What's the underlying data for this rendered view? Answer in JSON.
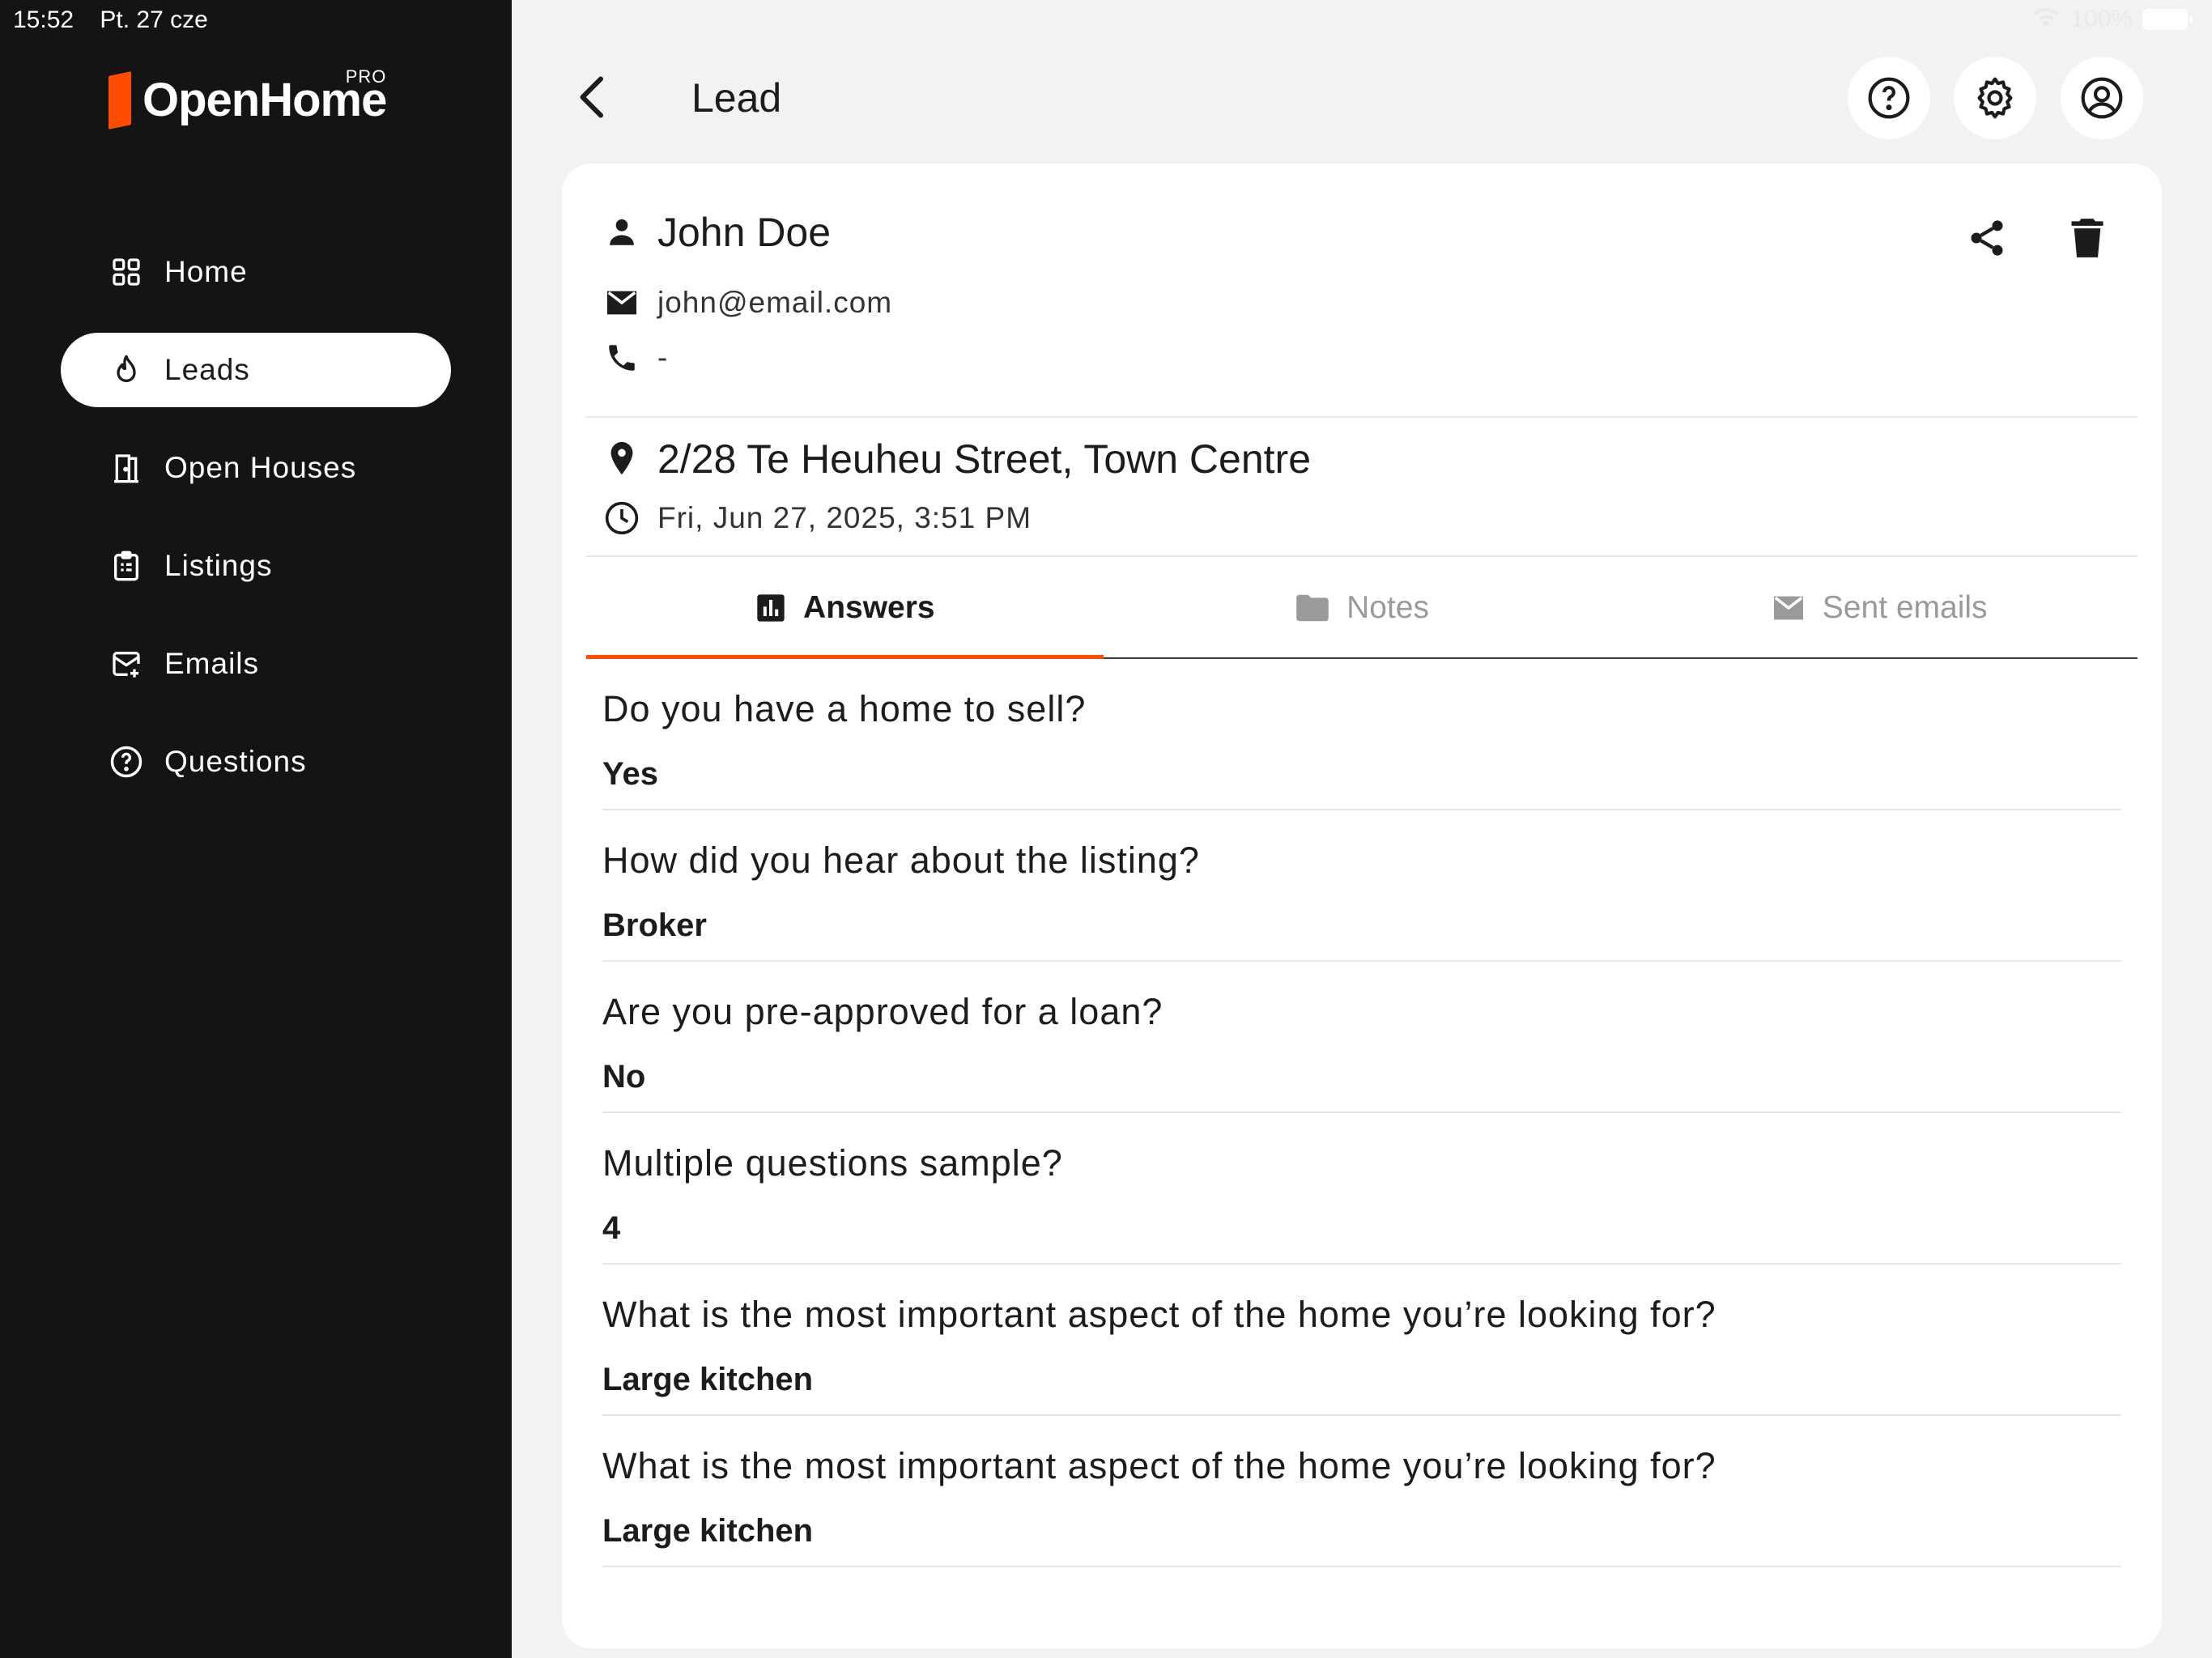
{
  "status_bar": {
    "time": "15:52",
    "date": "Pt. 27 cze",
    "battery": "100%"
  },
  "brand": {
    "name": "OpenHome",
    "badge": "PRO"
  },
  "nav": {
    "items": [
      {
        "label": "Home",
        "icon": "grid-icon"
      },
      {
        "label": "Leads",
        "icon": "flame-icon"
      },
      {
        "label": "Open Houses",
        "icon": "door-icon"
      },
      {
        "label": "Listings",
        "icon": "clipboard-icon"
      },
      {
        "label": "Emails",
        "icon": "mail-icon"
      },
      {
        "label": "Questions",
        "icon": "question-icon"
      }
    ],
    "active": "Leads"
  },
  "header": {
    "title": "Lead"
  },
  "lead": {
    "name": "John Doe",
    "email": "john@email.com",
    "phone": "-",
    "address": "2/28 Te Heuheu Street, Town Centre",
    "datetime": "Fri, Jun 27, 2025, 3:51 PM"
  },
  "tabs": [
    {
      "label": "Answers",
      "icon": "bar-chart-icon"
    },
    {
      "label": "Notes",
      "icon": "folder-icon"
    },
    {
      "label": "Sent emails",
      "icon": "mail-icon"
    }
  ],
  "answers": [
    {
      "question": "Do you have a home to sell?",
      "answer": "Yes"
    },
    {
      "question": "How did you hear about the listing?",
      "answer": "Broker"
    },
    {
      "question": "Are you pre-approved for a loan?",
      "answer": "No"
    },
    {
      "question": "Multiple questions sample?",
      "answer": "4"
    },
    {
      "question": "What is the most important aspect of the home you’re looking for?",
      "answer": "Large kitchen"
    },
    {
      "question": "What is the most important aspect of the home you’re looking for?",
      "answer": "Large kitchen"
    }
  ],
  "colors": {
    "accent": "#ff4c00",
    "sidebar": "#141414",
    "background": "#f2f2f2"
  }
}
